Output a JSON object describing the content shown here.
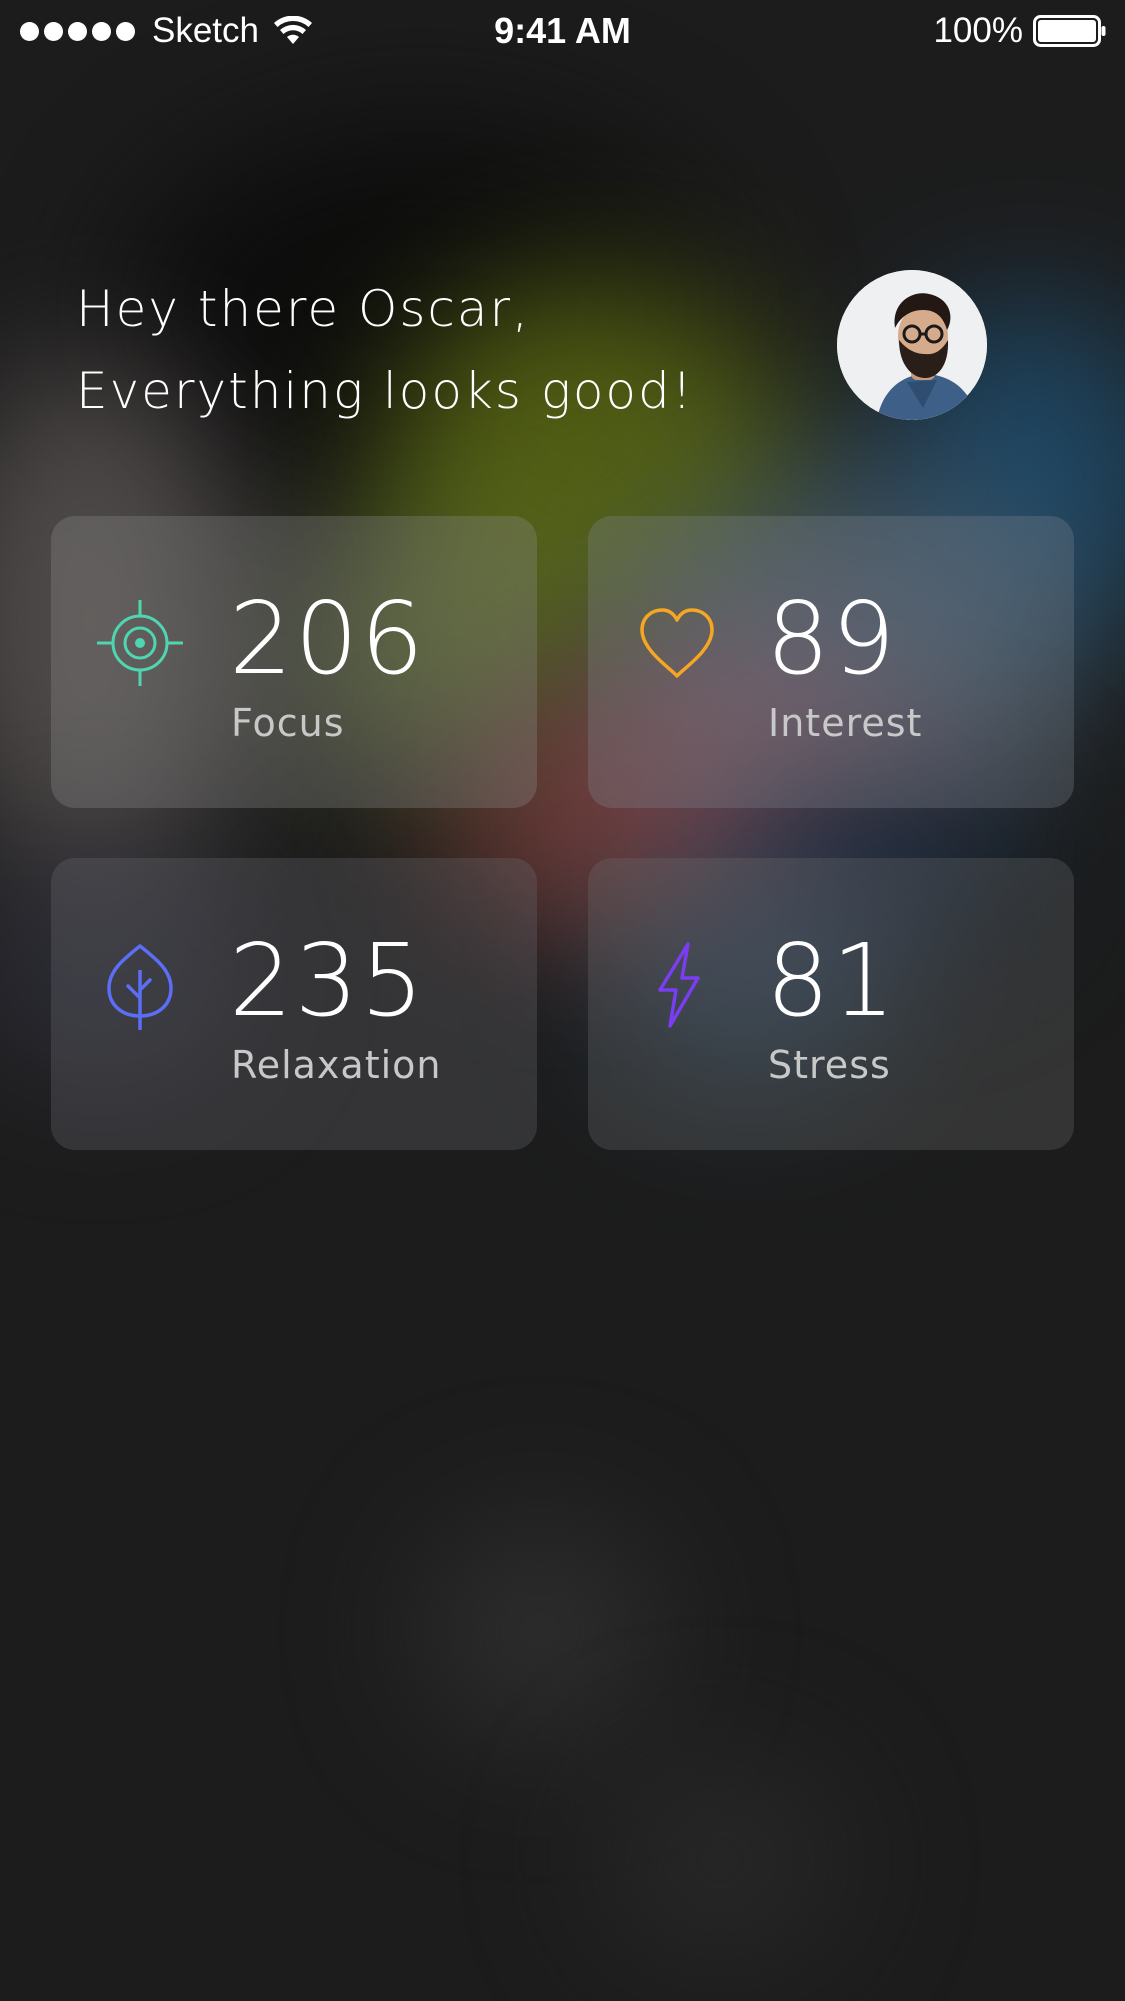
{
  "status_bar": {
    "carrier": "Sketch",
    "time": "9:41 AM",
    "battery": "100%"
  },
  "greeting": {
    "line1": "Hey there Oscar,",
    "line2": "Everything looks good!"
  },
  "metrics": [
    {
      "value": "206",
      "label": "Focus",
      "icon": "target-icon",
      "color": "#4fd6b0"
    },
    {
      "value": "89",
      "label": "Interest",
      "icon": "heart-icon",
      "color": "#f5a623"
    },
    {
      "value": "235",
      "label": "Relaxation",
      "icon": "leaf-icon",
      "color": "#5b6ef5"
    },
    {
      "value": "81",
      "label": "Stress",
      "icon": "lightning-icon",
      "color": "#7a3df2"
    }
  ]
}
